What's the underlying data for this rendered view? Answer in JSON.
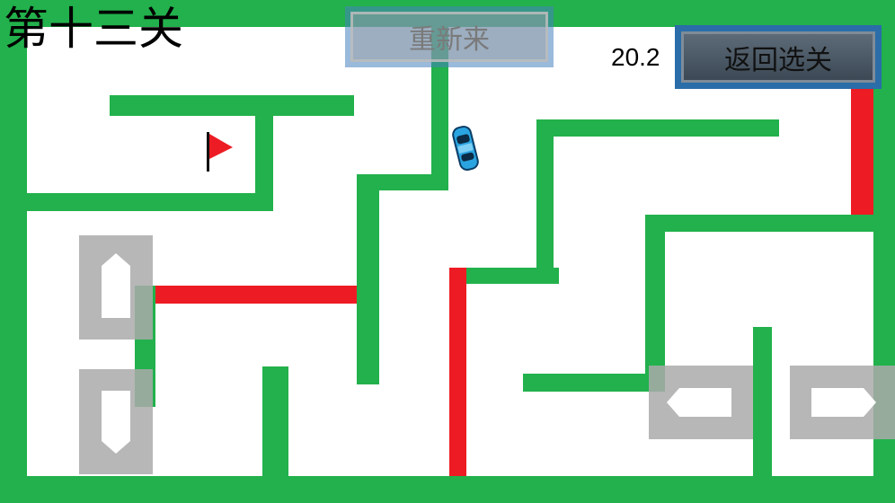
{
  "level": {
    "title": "第十三关"
  },
  "timer": {
    "value": "20.2"
  },
  "buttons": {
    "restart_label": "重新来",
    "back_label": "返回选关"
  },
  "icons": {
    "flag": "red-flag-icon",
    "car": "blue-car-icon",
    "controls": [
      "up-arrow-control",
      "down-arrow-control",
      "left-arrow-control",
      "right-arrow-control"
    ]
  },
  "colors": {
    "wall": "#22b14c",
    "hazard": "#ed1c24",
    "car": "#2aa4e0",
    "flag": "#ed1c24",
    "back_button": "#2a6da8"
  }
}
